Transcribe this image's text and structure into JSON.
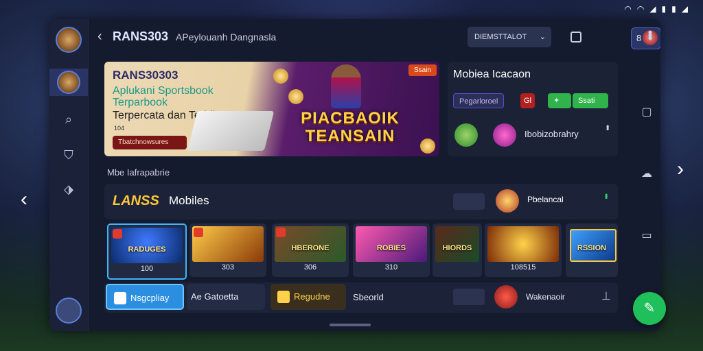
{
  "status_bar": {
    "icons": [
      "wifi-icon",
      "wifi-icon",
      "signal-icon",
      "battery-icon",
      "battery-icon",
      "signal-icon"
    ]
  },
  "header": {
    "brand": "RANS303",
    "subtitle": "APeylouanh Dangnasla",
    "dropdown_value": "DIEMSTTALOT",
    "badge_count": "8"
  },
  "hero": {
    "title": "RANS30303",
    "tagline": "Aplukani Sportsbook Terparbook",
    "headline": "Terpercata dan Terbik",
    "small": "104",
    "cta_label": "Tbatchnowsures",
    "tag_label": "Ssain",
    "big_text": "PIACBAOIK TEANSAIN"
  },
  "side_panel": {
    "title": "Mobiea Icacaon",
    "chip_register": "Pegarloroel",
    "chip_short": "Gl",
    "chip_green_a": "",
    "chip_green_b": "Ssati",
    "row_text": "Ibobizobrahry"
  },
  "section_label": "Mbe Iafrapabrie",
  "lane": {
    "logo": "LANSS",
    "label": "Mobiles",
    "right_label": "Pbelancal"
  },
  "cards": [
    {
      "title": "RADUGES",
      "label": "100"
    },
    {
      "title": "",
      "label": "303"
    },
    {
      "title": "HBERONE",
      "label": "306"
    },
    {
      "title": "ROBIES",
      "label": "310"
    },
    {
      "title": "HIORDS",
      "label": ""
    },
    {
      "title": "",
      "label": "108515"
    },
    {
      "title": "RSSION",
      "label": ""
    }
  ],
  "bottom": {
    "btn_primary": "Nsgcpliay",
    "btn_secondary": "Ae Gatoetta",
    "btn_yellow": "Regudne",
    "text_mid": "Sbeorld",
    "text_right": "Wakenaoir"
  },
  "colors": {
    "accent_blue": "#3fd0ff",
    "accent_green": "#1fbf5c",
    "accent_gold": "#ffc83a",
    "panel_bg": "#1c2338"
  }
}
